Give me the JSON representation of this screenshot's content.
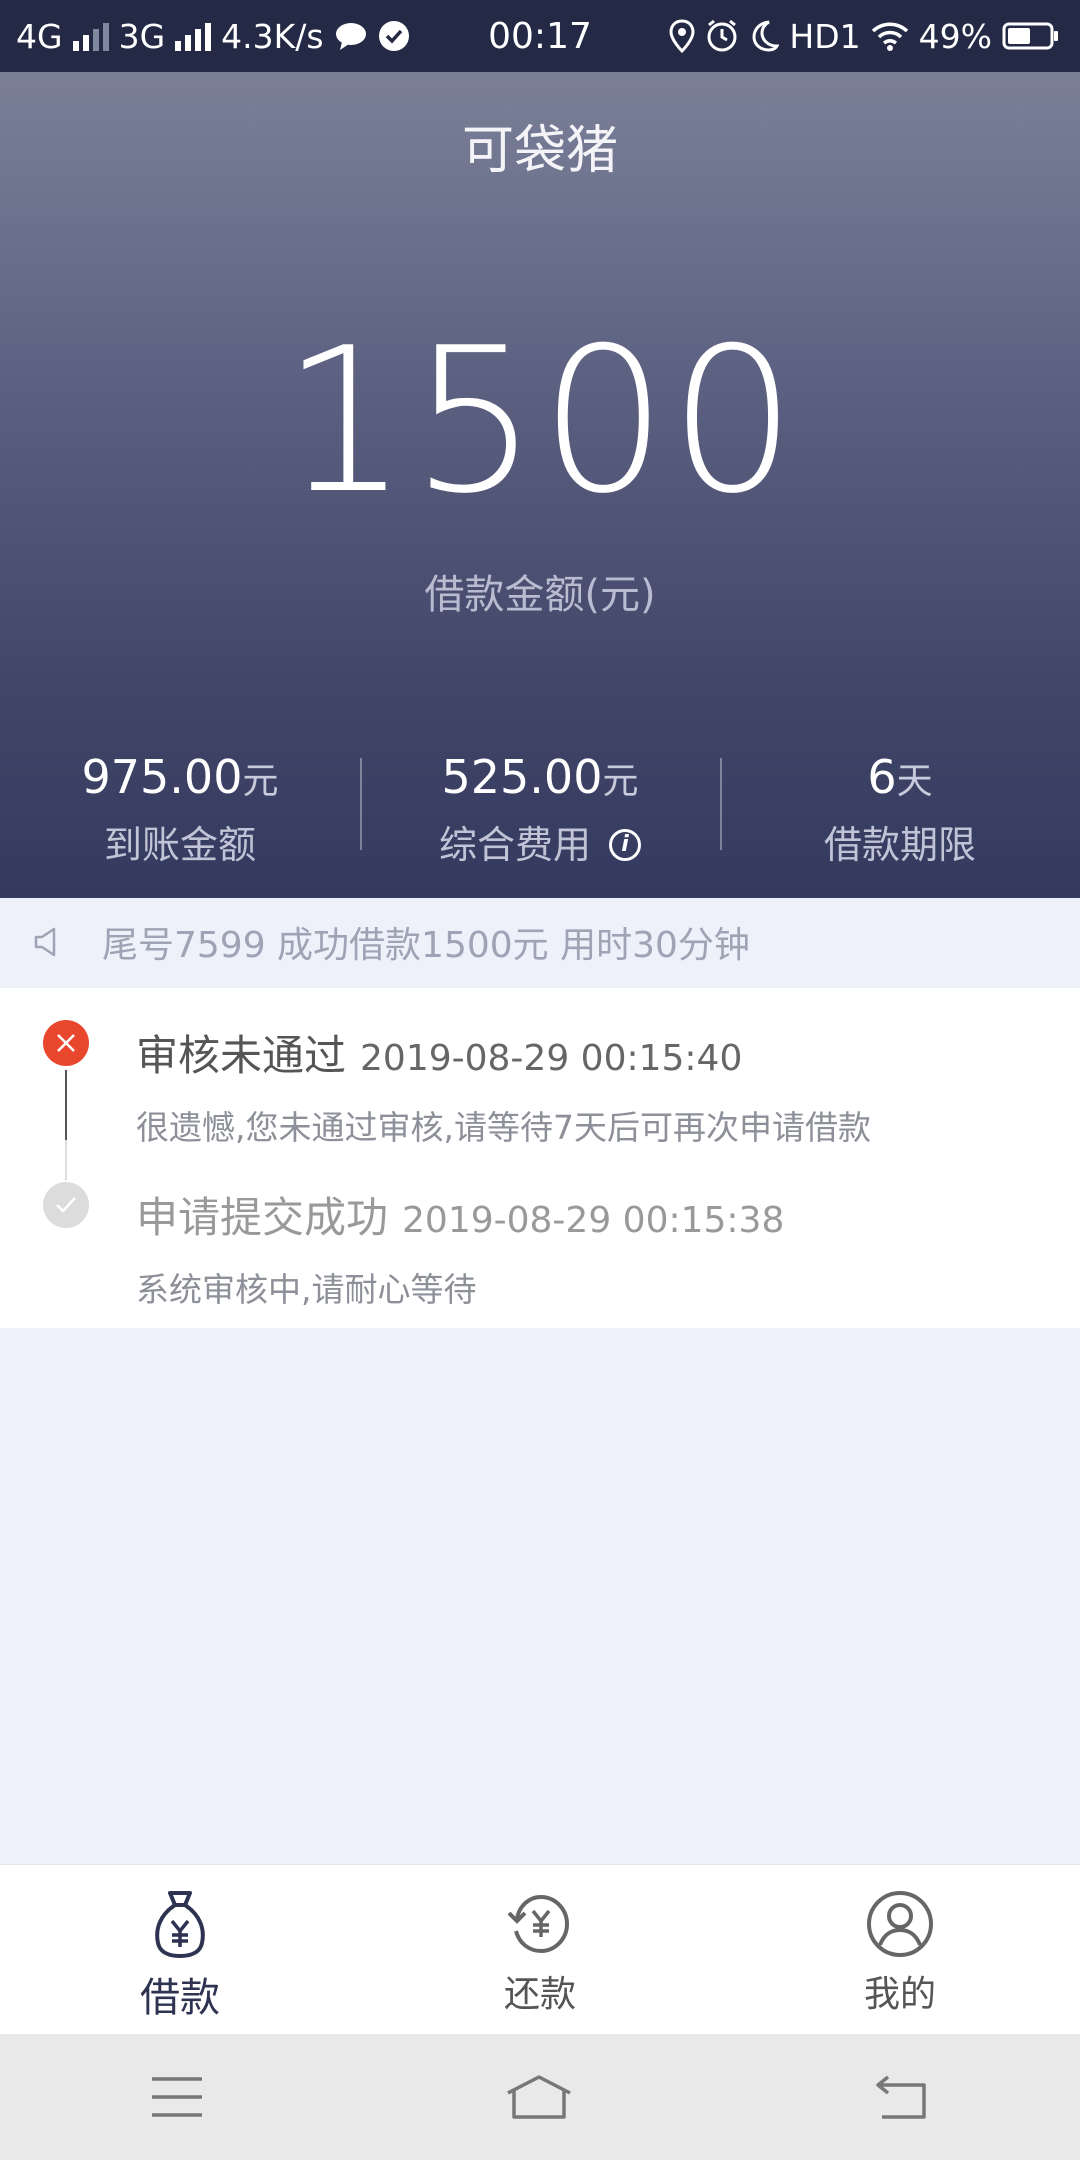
{
  "status_bar": {
    "network1": "4G",
    "network2": "3G",
    "speed": "4.3K/s",
    "time": "00:17",
    "hd": "HD1",
    "battery": "49%"
  },
  "app": {
    "title": "可袋猪"
  },
  "loan": {
    "amount": "1500",
    "amount_label": "借款金额(元)",
    "stats": [
      {
        "value": "975.00",
        "unit": "元",
        "label": "到账金额"
      },
      {
        "value": "525.00",
        "unit": "元",
        "label": "综合费用"
      },
      {
        "value": "6",
        "unit": "天",
        "label": "借款期限"
      }
    ]
  },
  "notice": {
    "text": "尾号7599 成功借款1500元 用时30分钟"
  },
  "timeline": [
    {
      "title": "审核未通过",
      "time": "2019-08-29 00:15:40",
      "desc": "很遗憾,您未通过审核,请等待7天后可再次申请借款",
      "status": "rejected"
    },
    {
      "title": "申请提交成功",
      "time": "2019-08-29 00:15:38",
      "desc": "系统审核中,请耐心等待",
      "status": "done"
    }
  ],
  "tabs": [
    {
      "label": "借款",
      "icon": "money-bag-icon",
      "active": true
    },
    {
      "label": "还款",
      "icon": "repay-icon",
      "active": false
    },
    {
      "label": "我的",
      "icon": "user-profile-icon",
      "active": false
    }
  ],
  "colors": {
    "accent": "#2d3350",
    "reject": "#e8472d",
    "hero_top": "#7b8098",
    "hero_bottom": "#343a5f"
  }
}
